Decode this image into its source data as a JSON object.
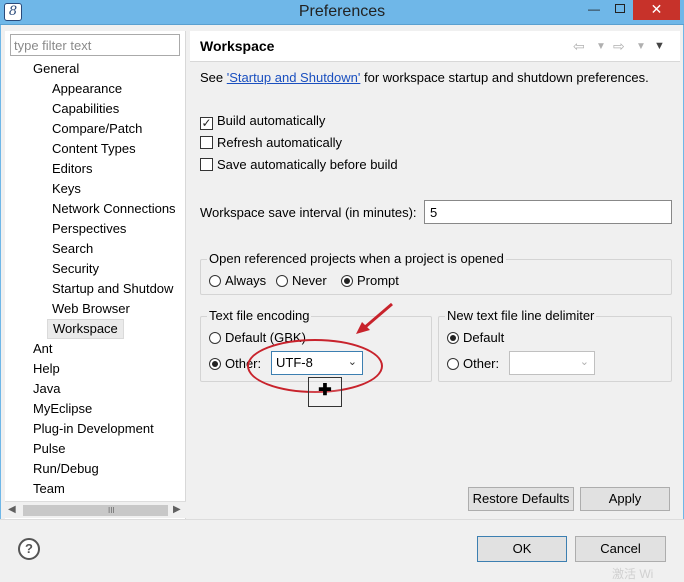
{
  "window": {
    "title": "Preferences",
    "app_icon": "eclipse-icon",
    "controls": {
      "minimize": "—",
      "close": "✕"
    }
  },
  "filter": {
    "placeholder": "type filter text",
    "value": ""
  },
  "tree": {
    "items": [
      {
        "label": "General",
        "level": 0,
        "selected": false
      },
      {
        "label": "Appearance",
        "level": 1,
        "selected": false
      },
      {
        "label": "Capabilities",
        "level": 1,
        "selected": false
      },
      {
        "label": "Compare/Patch",
        "level": 1,
        "selected": false
      },
      {
        "label": "Content Types",
        "level": 1,
        "selected": false
      },
      {
        "label": "Editors",
        "level": 1,
        "selected": false
      },
      {
        "label": "Keys",
        "level": 1,
        "selected": false
      },
      {
        "label": "Network Connections",
        "level": 1,
        "selected": false
      },
      {
        "label": "Perspectives",
        "level": 1,
        "selected": false
      },
      {
        "label": "Search",
        "level": 1,
        "selected": false
      },
      {
        "label": "Security",
        "level": 1,
        "selected": false
      },
      {
        "label": "Startup and Shutdow",
        "level": 1,
        "selected": false
      },
      {
        "label": "Web Browser",
        "level": 1,
        "selected": false
      },
      {
        "label": "Workspace",
        "level": 1,
        "selected": true
      },
      {
        "label": "Ant",
        "level": 0,
        "selected": false
      },
      {
        "label": "Help",
        "level": 0,
        "selected": false
      },
      {
        "label": "Java",
        "level": 0,
        "selected": false
      },
      {
        "label": "MyEclipse",
        "level": 0,
        "selected": false
      },
      {
        "label": "Plug-in Development",
        "level": 0,
        "selected": false
      },
      {
        "label": "Pulse",
        "level": 0,
        "selected": false
      },
      {
        "label": "Run/Debug",
        "level": 0,
        "selected": false
      },
      {
        "label": "Team",
        "level": 0,
        "selected": false
      }
    ],
    "scrollbar": {
      "left_arrow": "◀",
      "right_arrow": "▶",
      "grip": "III"
    }
  },
  "page": {
    "title": "Workspace",
    "nav_icons": [
      "back-arrow-icon",
      "back-dropdown-icon",
      "forward-arrow-icon",
      "forward-dropdown-icon",
      "view-menu-icon"
    ],
    "see_prefix": "See ",
    "see_link": "'Startup and Shutdown'",
    "see_suffix": " for workspace startup and shutdown preferences.",
    "options": {
      "build_auto": {
        "label": "Build automatically",
        "checked": true
      },
      "refresh_auto": {
        "label": "Refresh automatically",
        "checked": false
      },
      "save_auto": {
        "label": "Save automatically before build",
        "checked": false
      }
    },
    "save_interval": {
      "label": "Workspace save interval (in minutes):",
      "value": "5"
    },
    "open_projects": {
      "title": "Open referenced projects when a project is opened",
      "options": [
        {
          "label": "Always",
          "selected": false
        },
        {
          "label": "Never",
          "selected": false
        },
        {
          "label": "Prompt",
          "selected": true
        }
      ]
    },
    "encoding": {
      "title": "Text file encoding",
      "default_label": "Default (GBK)",
      "default_selected": false,
      "other_label": "Other:",
      "other_selected": true,
      "other_value": "UTF-8"
    },
    "line_delimiter": {
      "title": "New text file line delimiter",
      "default_label": "Default",
      "default_selected": true,
      "other_label": "Other:",
      "other_selected": false,
      "other_value": ""
    },
    "restore_defaults": "Restore Defaults",
    "apply": "Apply"
  },
  "footer": {
    "ok": "OK",
    "cancel": "Cancel",
    "help": "?"
  },
  "annotation": {
    "cursor": "✚",
    "highlight_color": "#c8232c"
  },
  "watermark": "激活 Wi"
}
